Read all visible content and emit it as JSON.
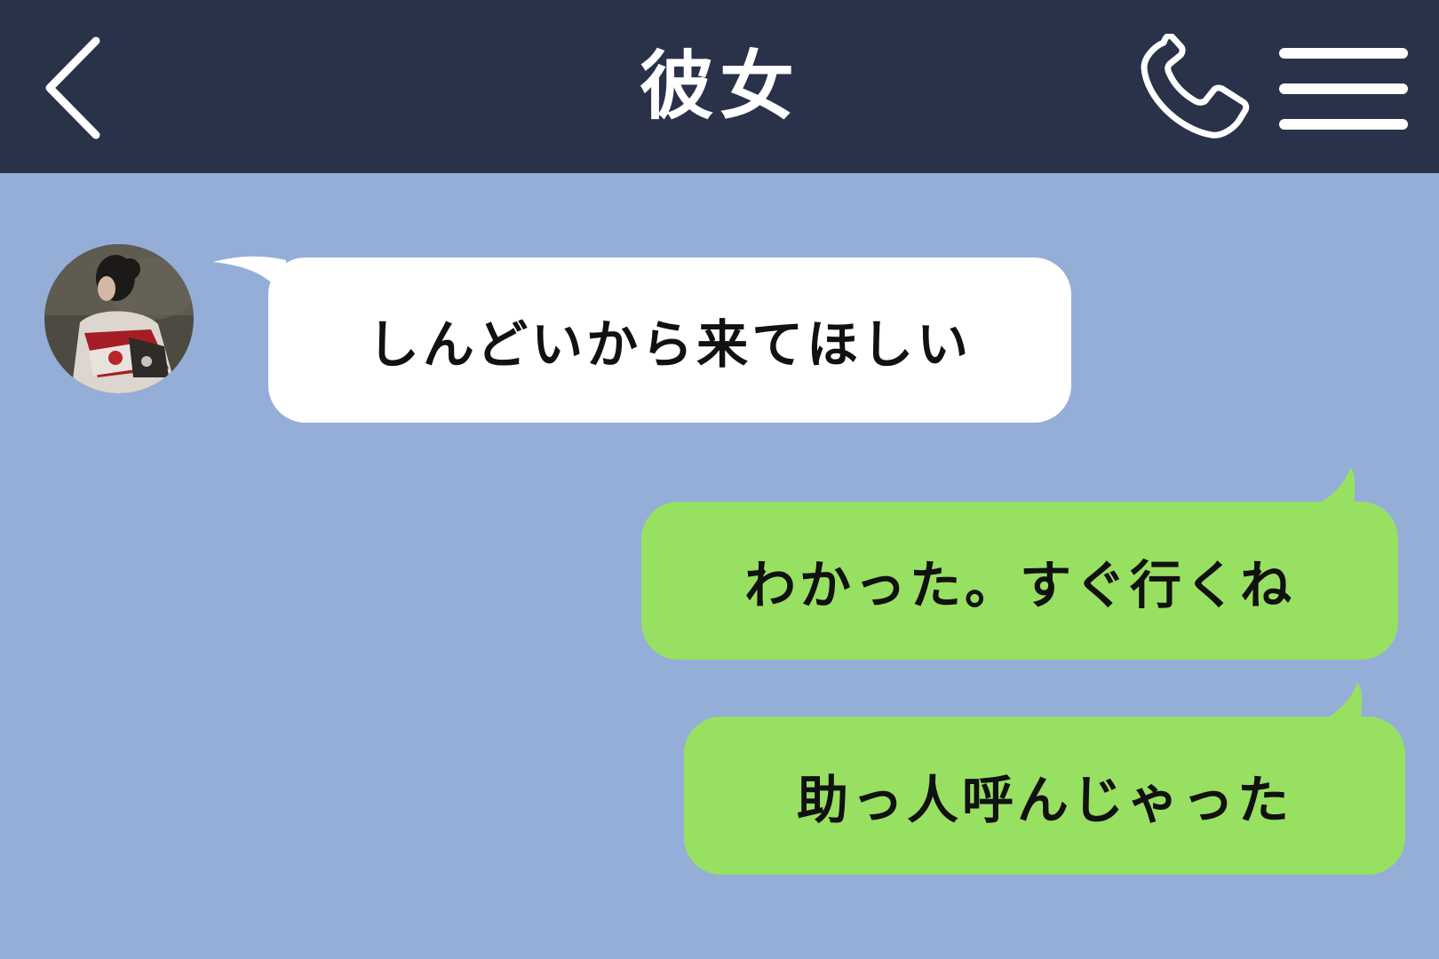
{
  "header": {
    "title": "彼女",
    "back_icon": "chevron-left-icon",
    "call_icon": "phone-icon",
    "menu_icon": "hamburger-menu-icon",
    "background_color": "#293249",
    "text_color": "#ffffff"
  },
  "chat": {
    "background_color": "#95aed7",
    "incoming_bubble_color": "#ffffff",
    "outgoing_bubble_color": "#98e062",
    "messages": [
      {
        "direction": "incoming",
        "text": "しんどいから来てほしい"
      },
      {
        "direction": "outgoing",
        "text": "わかった。すぐ行くね"
      },
      {
        "direction": "outgoing",
        "text": "助っ人呼んじゃった"
      }
    ]
  }
}
